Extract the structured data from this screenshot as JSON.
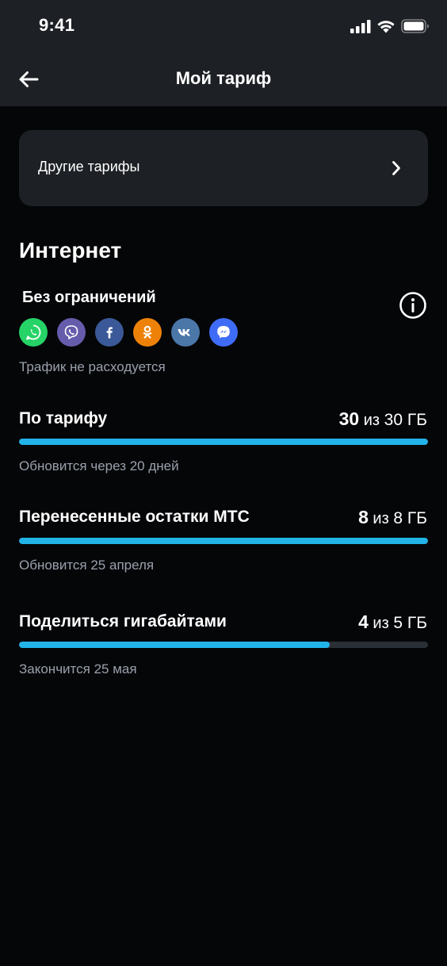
{
  "status_bar": {
    "time": "9:41"
  },
  "header": {
    "title": "Мой тариф"
  },
  "other_tariffs": {
    "label": "Другие тарифы"
  },
  "internet": {
    "title": "Интернет",
    "unlimited": {
      "title": "Без ограничений",
      "apps": [
        {
          "name": "whatsapp-icon",
          "color": "#25d366"
        },
        {
          "name": "viber-icon",
          "color": "#665cac"
        },
        {
          "name": "facebook-icon",
          "color": "#3b5998"
        },
        {
          "name": "odnoklassniki-icon",
          "color": "#ee8208"
        },
        {
          "name": "vk-icon",
          "color": "#4a76a8"
        },
        {
          "name": "messenger-icon",
          "color": "#3f6cf6"
        }
      ],
      "note": "Трафик не расходуется"
    },
    "packages": [
      {
        "title": "По тарифу",
        "value": "30",
        "sep": " из ",
        "total": "30 ГБ",
        "progress": 1.0,
        "note": "Обновится через 20 дней"
      },
      {
        "title": "Перенесенные остатки МТС",
        "value": "8",
        "sep": " из ",
        "total": "8 ГБ",
        "progress": 1.0,
        "note": "Обновится 25 апреля"
      },
      {
        "title": "Поделиться гигабайтами",
        "value": "4",
        "sep": " из ",
        "total": "5 ГБ",
        "progress": 0.76,
        "note": "Закончится 25 мая"
      }
    ]
  },
  "colors": {
    "accent": "#22b3e8",
    "card_bg": "#1d2025",
    "page_bg": "#050608",
    "muted_text": "#9aa1ac"
  }
}
